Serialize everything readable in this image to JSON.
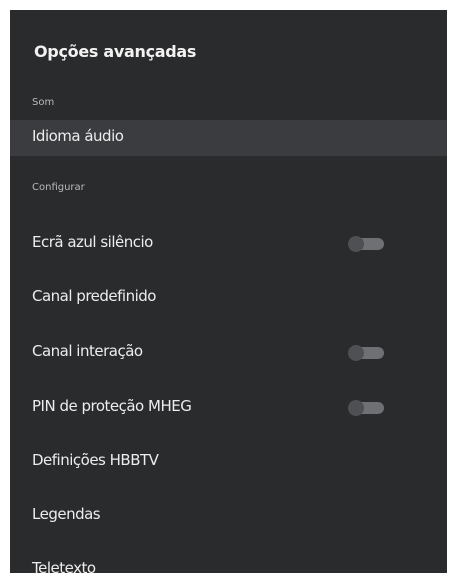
{
  "screen": {
    "title": "Opções avançadas"
  },
  "sections": [
    {
      "label": "Som",
      "items": [
        {
          "label": "Idioma áudio",
          "focused": true
        }
      ]
    },
    {
      "label": "Configurar",
      "items": [
        {
          "label": "Ecrã azul silêncio",
          "toggle": "off"
        },
        {
          "label": "Canal predefinido"
        },
        {
          "label": "Canal interação",
          "toggle": "off"
        },
        {
          "label": "PIN de proteção MHEG",
          "toggle": "off"
        },
        {
          "label": "Definições HBBTV"
        },
        {
          "label": "Legendas"
        },
        {
          "label": "Teletexto"
        }
      ]
    }
  ],
  "colors": {
    "panel_background": "#2a2b2d",
    "focused_row": "#3b3c3f",
    "toggle_track": "#6f7073",
    "toggle_thumb_off": "#4f5053"
  }
}
